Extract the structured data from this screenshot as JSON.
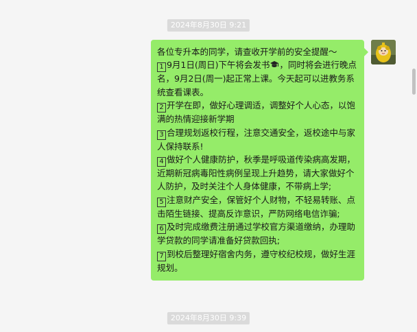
{
  "chat": {
    "timestamps": [
      "2024年8月30日 9:21",
      "2024年8月30日 9:39"
    ],
    "message": {
      "intro": "各位专升本的同学，请查收开学前的安全提醒～",
      "items": [
        {
          "num": "1",
          "text_before_icon": "9月1日(周日)下午将会发书",
          "text_after_icon": "，同时将会进行晚点名，9月2日(周一)起正常上课。今天起可以进教务系统查看课表。"
        },
        {
          "num": "2",
          "text": "开学在即，做好心理调适，调整好个人心态，以饱满的热情迎接新学期"
        },
        {
          "num": "3",
          "text": "合理规划返校行程，注意交通安全，返校途中与家人保持联系!"
        },
        {
          "num": "4",
          "text": "做好个人健康防护，秋季是呼吸道传染病高发期，近期新冠病毒阳性病例呈现上升趋势，请大家做好个人防护，及时关注个人身体健康，不带病上学;"
        },
        {
          "num": "5",
          "text": "注意财产安全，保管好个人财物，不轻易转账、点击陌生链接、提高反诈意识，严防网络电信诈骗;"
        },
        {
          "num": "6",
          "text": "及时完成缴费注册通过学校官方渠道缴纳，办理助学贷款的同学请准备好贷款回执;"
        },
        {
          "num": "7",
          "text": "到校后整理好宿舍内务，遵守校纪校规，做好生涯规划。"
        }
      ],
      "bubble_color": "#95ec69",
      "inline_icon": "graduation-cap-icon"
    },
    "avatar": "user-avatar"
  }
}
